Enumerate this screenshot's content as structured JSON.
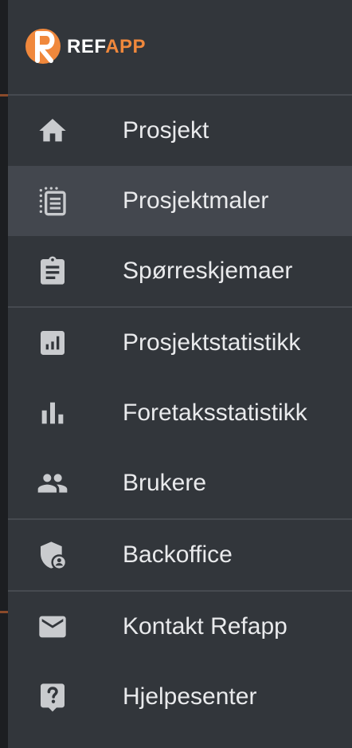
{
  "brand": {
    "logo_letter": "R",
    "name_part1": "REF",
    "name_part2": "APP",
    "accent_color": "#f0883c"
  },
  "menu": {
    "items": [
      {
        "label": "Prosjekt",
        "icon": "home-icon",
        "active": false
      },
      {
        "label": "Prosjektmaler",
        "icon": "template-list-icon",
        "active": true
      },
      {
        "label": "Spørreskjemaer",
        "icon": "clipboard-icon",
        "active": false
      },
      {
        "label": "Prosjektstatistikk",
        "icon": "analytics-icon",
        "active": false
      },
      {
        "label": "Foretaksstatistikk",
        "icon": "bar-chart-icon",
        "active": false
      },
      {
        "label": "Brukere",
        "icon": "people-icon",
        "active": false
      },
      {
        "label": "Backoffice",
        "icon": "admin-shield-icon",
        "active": false
      },
      {
        "label": "Kontakt Refapp",
        "icon": "mail-icon",
        "active": false
      },
      {
        "label": "Hjelpesenter",
        "icon": "help-icon",
        "active": false
      }
    ]
  },
  "colors": {
    "sidebar_bg": "#32363b",
    "active_bg": "#43474e",
    "divider": "#464a50",
    "icon": "#c9cbce",
    "text": "#e9eaec"
  }
}
